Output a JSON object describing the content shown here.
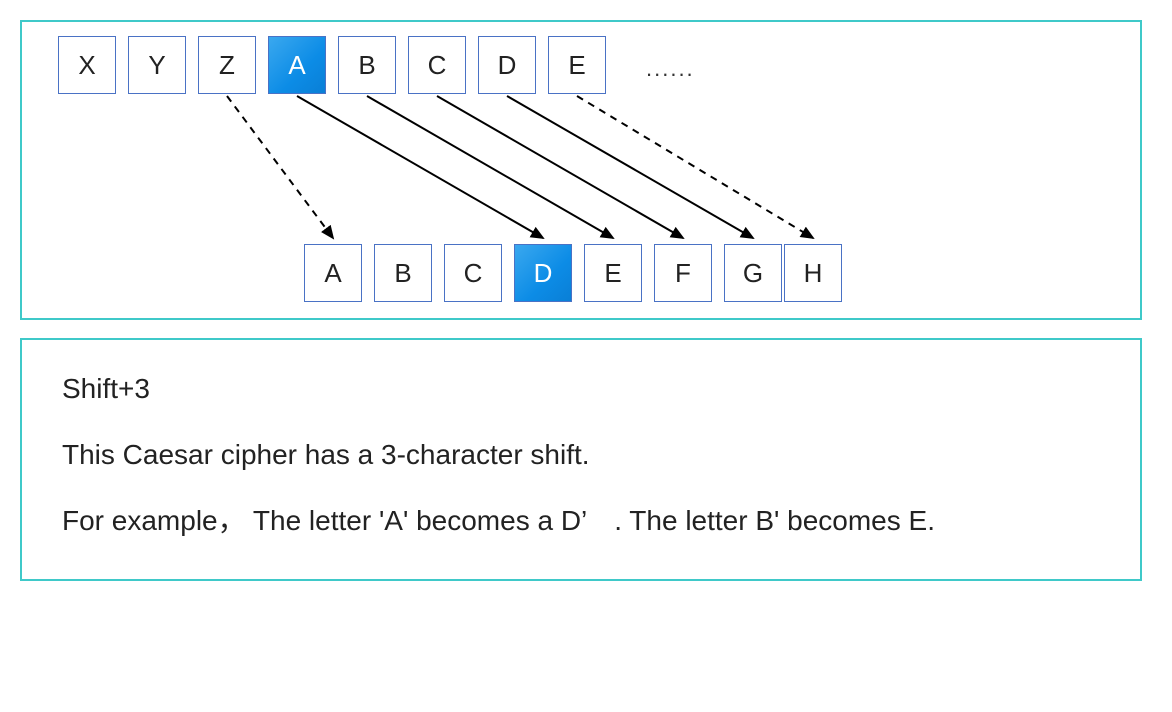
{
  "diagram": {
    "topRow": {
      "cells": [
        {
          "letter": "X",
          "highlight": false
        },
        {
          "letter": "Y",
          "highlight": false
        },
        {
          "letter": "Z",
          "highlight": false
        },
        {
          "letter": "A",
          "highlight": true
        },
        {
          "letter": "B",
          "highlight": false
        },
        {
          "letter": "C",
          "highlight": false
        },
        {
          "letter": "D",
          "highlight": false
        },
        {
          "letter": "E",
          "highlight": false
        }
      ],
      "ellipsis": "......"
    },
    "bottomRow": {
      "cells": [
        {
          "letter": "A",
          "highlight": false
        },
        {
          "letter": "B",
          "highlight": false
        },
        {
          "letter": "C",
          "highlight": false
        },
        {
          "letter": "D",
          "highlight": true
        },
        {
          "letter": "E",
          "highlight": false
        },
        {
          "letter": "F",
          "highlight": false
        },
        {
          "letter": "G",
          "highlight": false
        },
        {
          "letter": "H",
          "highlight": false
        }
      ]
    },
    "arrows": [
      {
        "from": 2,
        "to": 0,
        "dashed": true
      },
      {
        "from": 3,
        "to": 3,
        "dashed": false
      },
      {
        "from": 4,
        "to": 4,
        "dashed": false
      },
      {
        "from": 5,
        "to": 5,
        "dashed": false
      },
      {
        "from": 6,
        "to": 6,
        "dashed": false
      },
      {
        "from": 7,
        "to": 7,
        "dashed": true
      }
    ]
  },
  "description": {
    "line1": "Shift+3",
    "line2": "This Caesar cipher has a 3-character shift.",
    "line3": "For example， The letter 'A' becomes a D’　. The letter B' becomes E."
  }
}
